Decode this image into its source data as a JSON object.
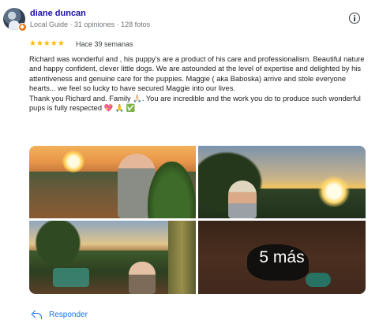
{
  "review": {
    "author": {
      "name": "diane duncan",
      "meta": "Local Guide · 31 opiniones · 128 fotos",
      "avatar_icon": "avatar",
      "badge_icon": "local-guide-badge-icon"
    },
    "more_options_icon": "info-icon",
    "rating": {
      "stars": "★★★★★",
      "value": 5,
      "max": 5,
      "star_color": "#fbbc04"
    },
    "time": "Hace 39 semanas",
    "text": [
      "Richard was wonderful and , his puppy's are a product of his care and professionalism. Beautiful nature and happy confident, clever little dogs. We are astounded at the level of expertise and delighted by his attentiveness and genuine care for the puppies. Maggie ( aka Baboska) arrive and stole everyone hearts... we feel so lucky to have secured Maggie into our lives.",
      "Thank you Richard and. Family 🙏🏻. You are incredible and the work you do to produce such wonderful pups is fully respected 💖 🙏 ✅"
    ],
    "photos": {
      "more_label": "5 más"
    },
    "reply": {
      "label": "Responder",
      "icon": "reply-icon"
    }
  },
  "colors": {
    "link_blue": "#1a73e8",
    "author_blue": "#1a0dab",
    "badge_orange": "#e8710a"
  }
}
